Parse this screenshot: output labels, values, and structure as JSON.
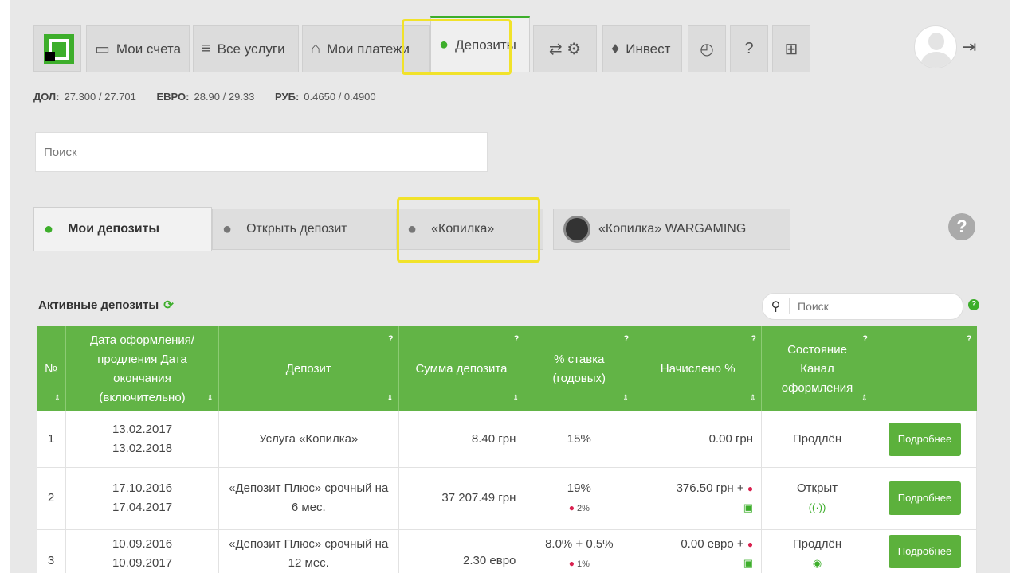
{
  "nav": {
    "tabs": [
      {
        "label": "Мои счета",
        "icon": "card-icon"
      },
      {
        "label": "Все услуги",
        "icon": "list-icon"
      },
      {
        "label": "Мои платежи",
        "icon": "house-icon"
      },
      {
        "label": "Депозиты",
        "icon": "piggy-bank-icon"
      },
      {
        "label": "",
        "icon": "transport-icon"
      },
      {
        "label": "Инвест",
        "icon": "money-bag-icon"
      },
      {
        "label": "",
        "icon": "clock-icon"
      },
      {
        "label": "",
        "icon": "question-icon"
      },
      {
        "label": "",
        "icon": "cart-icon"
      }
    ]
  },
  "rates": {
    "usd_label": "ДОЛ:",
    "usd": "27.300 / 27.701",
    "eur_label": "ЕВРО:",
    "eur": "28.90 / 29.33",
    "rub_label": "РУБ:",
    "rub": "0.4650 / 0.4900"
  },
  "search": {
    "placeholder": "Поиск"
  },
  "subtabs": [
    {
      "label": "Мои депозиты"
    },
    {
      "label": "Открыть депозит"
    },
    {
      "label": "«Копилка»"
    },
    {
      "label": "«Копилка» WARGAMING"
    }
  ],
  "active": {
    "title": "Активные депозиты",
    "search_placeholder": "Поиск"
  },
  "table": {
    "headers": {
      "num": "№",
      "date": "Дата оформления/ продления Дата окончания (включительно)",
      "deposit": "Депозит",
      "sum": "Сумма депозита",
      "rate": "% ставка (годовых)",
      "accrued": "Начислено %",
      "state": "Состояние Канал оформления"
    },
    "rows": [
      {
        "num": "1",
        "date1": "13.02.2017",
        "date2": "13.02.2018",
        "deposit": "Услуга «Копилка»",
        "sum": "8.40 грн",
        "rate": "15%",
        "rate_extra": "",
        "accrued": "0.00 грн",
        "state": "Продлён",
        "button": "Подробнее"
      },
      {
        "num": "2",
        "date1": "17.10.2016",
        "date2": "17.04.2017",
        "deposit": "«Депозит Плюс» срочный на 6 мес.",
        "sum": "37 207.49 грн",
        "rate": "19%",
        "rate_extra": "2%",
        "accrued": "376.50 грн +",
        "state": "Открыт",
        "button": "Подробнее"
      },
      {
        "num": "3",
        "date1": "10.09.2016",
        "date2": "10.09.2017",
        "deposit": "«Депозит Плюс» срочный на 12 мес.",
        "sum": "2.30 евро",
        "rate": "8.0% + 0.5%",
        "rate_extra": "1%",
        "accrued": "0.00 евро +",
        "state": "Продлён",
        "button": "Подробнее"
      }
    ]
  }
}
